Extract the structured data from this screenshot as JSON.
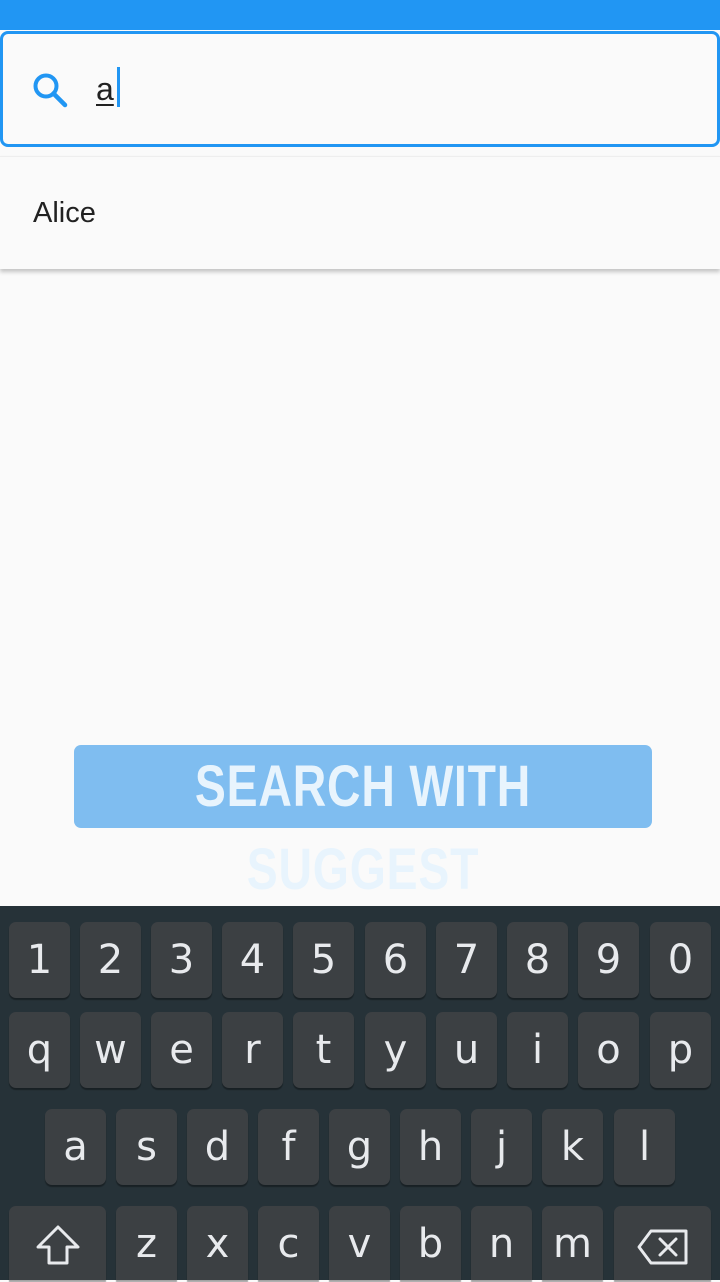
{
  "search": {
    "query": "a",
    "icon": "search-icon"
  },
  "suggestions": [
    {
      "label": "Alice"
    }
  ],
  "action_button": {
    "label": "SEARCH WITH SUGGEST"
  },
  "keyboard": {
    "row1": [
      "1",
      "2",
      "3",
      "4",
      "5",
      "6",
      "7",
      "8",
      "9",
      "0"
    ],
    "row2": [
      "q",
      "w",
      "e",
      "r",
      "t",
      "y",
      "u",
      "i",
      "o",
      "p"
    ],
    "row3": [
      "a",
      "s",
      "d",
      "f",
      "g",
      "h",
      "j",
      "k",
      "l"
    ],
    "row4": [
      "z",
      "x",
      "c",
      "v",
      "b",
      "n",
      "m"
    ],
    "shift_icon": "shift-icon",
    "backspace_icon": "backspace-icon"
  },
  "colors": {
    "accent": "#2196f3",
    "button_bg": "#7fbdf0",
    "keyboard_bg": "#263238",
    "key_bg": "#3c4043"
  }
}
